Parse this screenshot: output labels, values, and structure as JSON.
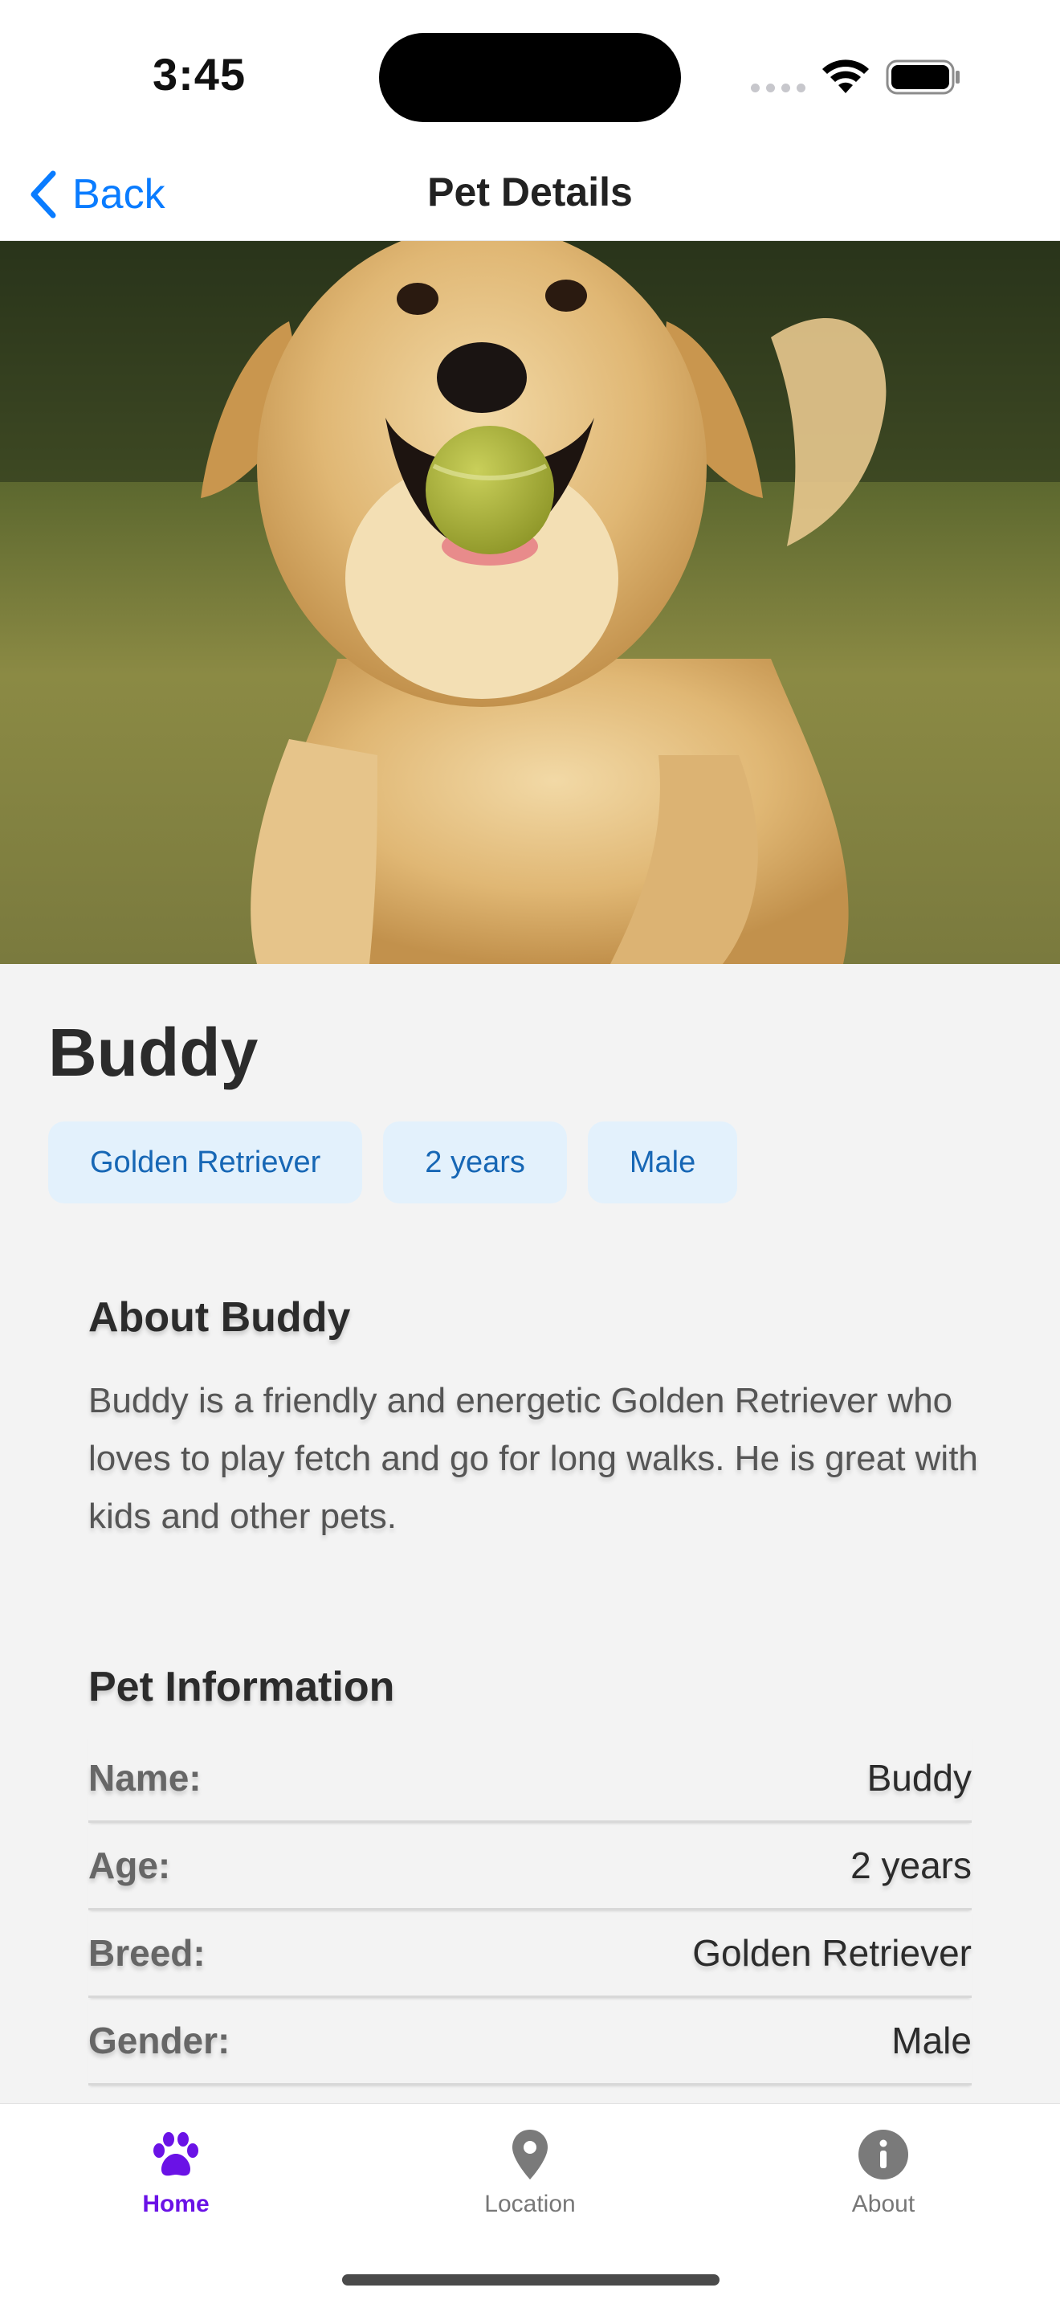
{
  "status_bar": {
    "time": "3:45"
  },
  "nav": {
    "back_label": "Back",
    "title": "Pet Details"
  },
  "hero": {
    "image_alt": "Golden retriever running with a tennis ball in its mouth"
  },
  "pet": {
    "name": "Buddy",
    "tags": [
      "Golden Retriever",
      "2 years",
      "Male"
    ]
  },
  "about": {
    "title": "About Buddy",
    "text": "Buddy is a friendly and energetic Golden Retriever who loves to play fetch and go for long walks. He is great with kids and other pets."
  },
  "info": {
    "title": "Pet Information",
    "rows": [
      {
        "label": "Name:",
        "value": "Buddy"
      },
      {
        "label": "Age:",
        "value": "2 years"
      },
      {
        "label": "Breed:",
        "value": "Golden Retriever"
      },
      {
        "label": "Gender:",
        "value": "Male"
      }
    ]
  },
  "tabs": [
    {
      "label": "Home",
      "icon": "paw-icon",
      "active": true
    },
    {
      "label": "Location",
      "icon": "location-pin-icon",
      "active": false
    },
    {
      "label": "About",
      "icon": "info-icon",
      "active": false
    }
  ],
  "colors": {
    "accent": "#0a7cff",
    "active_tab": "#6a12e6",
    "chip_bg": "#e3f1fc",
    "chip_text": "#1767b5",
    "content_bg": "#f3f3f3"
  }
}
